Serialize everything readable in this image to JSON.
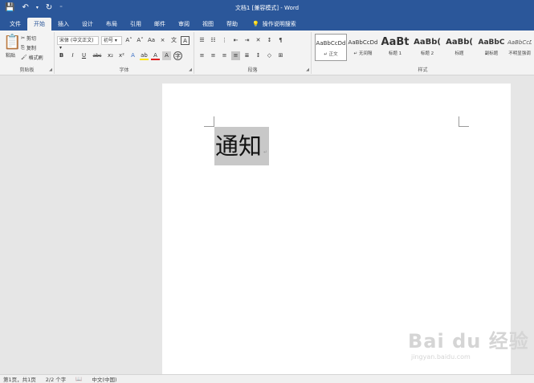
{
  "window": {
    "title": "文档1 [兼容模式] - Word"
  },
  "qat": {
    "save_icon": "💾",
    "undo_icon": "↶",
    "undo_dd": "▾",
    "redo_icon": "↻",
    "customize": "⁼"
  },
  "tabs": [
    {
      "label": "文件"
    },
    {
      "label": "开始"
    },
    {
      "label": "插入"
    },
    {
      "label": "设计"
    },
    {
      "label": "布局"
    },
    {
      "label": "引用"
    },
    {
      "label": "邮件"
    },
    {
      "label": "审阅"
    },
    {
      "label": "视图"
    },
    {
      "label": "帮助"
    }
  ],
  "tellme": {
    "icon": "💡",
    "label": "操作说明搜索"
  },
  "clipboard": {
    "paste_label": "粘贴",
    "paste_icon": "📋",
    "cut_icon": "✂",
    "cut_label": "剪切",
    "copy_icon": "⎘",
    "copy_label": "复制",
    "painter_icon": "🖌",
    "painter_label": "格式刷",
    "group_label": "剪贴板"
  },
  "font": {
    "font_name": "宋体 (中文正文)",
    "font_size": "初号",
    "grow": "A˄",
    "shrink": "A˅",
    "case": "Aa",
    "clear": "⨯",
    "phonetic": "文",
    "border": "A",
    "bold": "B",
    "italic": "I",
    "underline": "U",
    "strike": "abc",
    "sub": "x₂",
    "sup": "x²",
    "effects": "A",
    "highlight": "ab",
    "color": "A",
    "shade": "A",
    "circle": "字",
    "group_label": "字体"
  },
  "paragraph": {
    "bullets": "☰",
    "numbering": "☷",
    "multilevel": "⋮",
    "dec_indent": "⇤",
    "inc_indent": "⇥",
    "chinese": "✕",
    "sort": "↕",
    "show": "¶",
    "align_left": "≡",
    "center": "≡",
    "align_right": "≡",
    "justify": "≡",
    "distributed": "≣",
    "spacing": "↕",
    "shading": "◇",
    "borders": "⊞",
    "group_label": "段落"
  },
  "styles": {
    "items": [
      {
        "preview": "AaBbCcDd",
        "name": "↵ 正文"
      },
      {
        "preview": "AaBbCcDd",
        "name": "↵ 无间隔"
      },
      {
        "preview": "AaBt",
        "name": "标题 1"
      },
      {
        "preview": "AaBb(",
        "name": "标题 2"
      },
      {
        "preview": "AaBb(",
        "name": "标题"
      },
      {
        "preview": "AaBbC",
        "name": "副标题"
      },
      {
        "preview": "AaBbCcDd",
        "name": "不明显强调"
      }
    ],
    "group_label": "样式"
  },
  "document": {
    "text": "通知",
    "paragraph_mark": "↵"
  },
  "status": {
    "page": "第1页，共1页",
    "words": "2/2 个字",
    "proofing_icon": "📖",
    "language": "中文(中国)"
  },
  "watermark": {
    "logo": "Bai du 经验",
    "url": "jingyan.baidu.com"
  }
}
